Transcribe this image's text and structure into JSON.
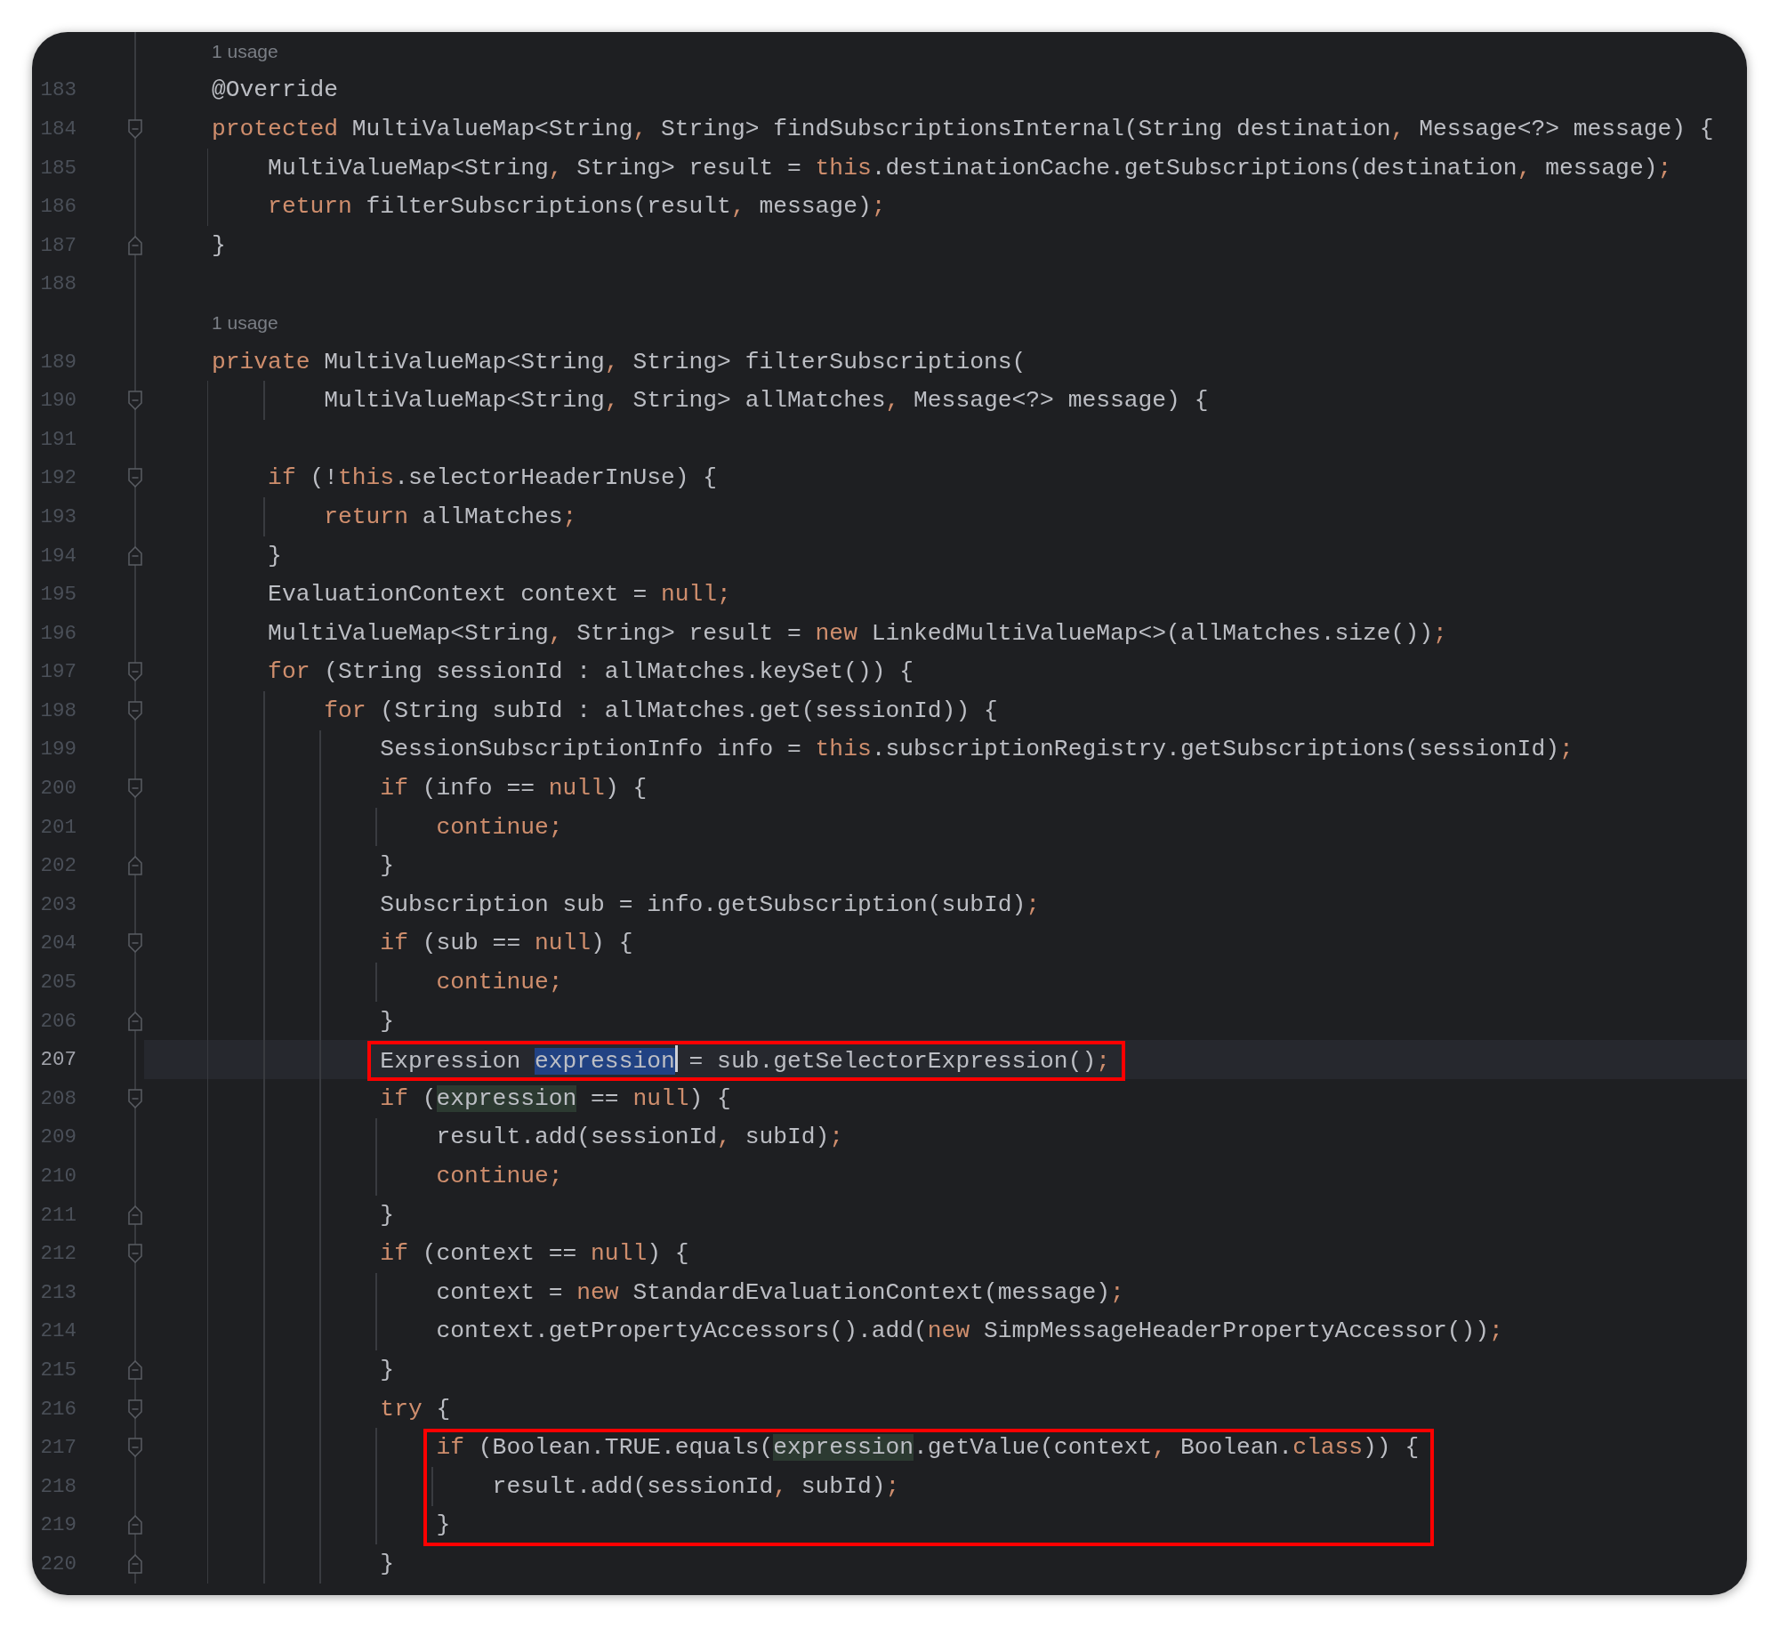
{
  "editor": {
    "lines": [
      {
        "kind": "usage",
        "text": "1 usage",
        "current": false,
        "boxed": false
      },
      {
        "kind": "code",
        "number": "183",
        "current": false,
        "boxed": false,
        "tokens": [
          {
            "kind": "plain",
            "text": "@Override"
          }
        ]
      },
      {
        "kind": "code",
        "number": "184",
        "current": false,
        "boxed": false,
        "fold": {
          "kind": "open"
        },
        "tokens": [
          {
            "kind": "keyword",
            "text": "protected"
          },
          {
            "kind": "plain",
            "text": " MultiValueMap<String"
          },
          {
            "kind": "keyword",
            "text": ","
          },
          {
            "kind": "plain",
            "text": " String> findSubscriptionsInternal(String destination"
          },
          {
            "kind": "keyword",
            "text": ","
          },
          {
            "kind": "plain",
            "text": " Message<?> message) {"
          }
        ]
      },
      {
        "kind": "code",
        "number": "185",
        "current": false,
        "boxed": false,
        "tokens": [
          {
            "kind": "plain",
            "text": "    MultiValueMap<String"
          },
          {
            "kind": "keyword",
            "text": ","
          },
          {
            "kind": "plain",
            "text": " String> result = "
          },
          {
            "kind": "keyword",
            "text": "this"
          },
          {
            "kind": "plain",
            "text": ".destinationCache.getSubscriptions(destination"
          },
          {
            "kind": "keyword",
            "text": ","
          },
          {
            "kind": "plain",
            "text": " message)"
          },
          {
            "kind": "keyword",
            "text": ";"
          }
        ]
      },
      {
        "kind": "code",
        "number": "186",
        "current": false,
        "boxed": false,
        "tokens": [
          {
            "kind": "keyword",
            "text": "    return"
          },
          {
            "kind": "plain",
            "text": " filterSubscriptions(result"
          },
          {
            "kind": "keyword",
            "text": ","
          },
          {
            "kind": "plain",
            "text": " message)"
          },
          {
            "kind": "keyword",
            "text": ";"
          }
        ]
      },
      {
        "kind": "code",
        "number": "187",
        "current": false,
        "boxed": false,
        "fold": {
          "kind": "close"
        },
        "tokens": [
          {
            "kind": "plain",
            "text": "}"
          }
        ]
      },
      {
        "kind": "code",
        "number": "188",
        "current": false,
        "boxed": false
      },
      {
        "kind": "usage",
        "text": "1 usage",
        "current": false,
        "boxed": false
      },
      {
        "kind": "code",
        "number": "189",
        "current": false,
        "boxed": false,
        "tokens": [
          {
            "kind": "keyword",
            "text": "private"
          },
          {
            "kind": "plain",
            "text": " MultiValueMap<String"
          },
          {
            "kind": "keyword",
            "text": ","
          },
          {
            "kind": "plain",
            "text": " String> filterSubscriptions("
          }
        ]
      },
      {
        "kind": "code",
        "number": "190",
        "current": false,
        "boxed": false,
        "fold": {
          "kind": "open"
        },
        "tokens": [
          {
            "kind": "plain",
            "text": "        MultiValueMap<String"
          },
          {
            "kind": "keyword",
            "text": ","
          },
          {
            "kind": "plain",
            "text": " String> allMatches"
          },
          {
            "kind": "keyword",
            "text": ","
          },
          {
            "kind": "plain",
            "text": " Message<?> message) {"
          }
        ]
      },
      {
        "kind": "code",
        "number": "191",
        "current": false,
        "boxed": false
      },
      {
        "kind": "code",
        "number": "192",
        "current": false,
        "boxed": false,
        "fold": {
          "kind": "open"
        },
        "tokens": [
          {
            "kind": "keyword",
            "text": "    if"
          },
          {
            "kind": "plain",
            "text": " (!"
          },
          {
            "kind": "keyword",
            "text": "this"
          },
          {
            "kind": "plain",
            "text": ".selectorHeaderInUse) {"
          }
        ]
      },
      {
        "kind": "code",
        "number": "193",
        "current": false,
        "boxed": false,
        "tokens": [
          {
            "kind": "keyword",
            "text": "        return"
          },
          {
            "kind": "plain",
            "text": " allMatches"
          },
          {
            "kind": "keyword",
            "text": ";"
          }
        ]
      },
      {
        "kind": "code",
        "number": "194",
        "current": false,
        "boxed": false,
        "fold": {
          "kind": "close"
        },
        "tokens": [
          {
            "kind": "plain",
            "text": "    }"
          }
        ]
      },
      {
        "kind": "code",
        "number": "195",
        "current": false,
        "boxed": false,
        "tokens": [
          {
            "kind": "plain",
            "text": "    EvaluationContext context = "
          },
          {
            "kind": "keyword",
            "text": "null;"
          }
        ]
      },
      {
        "kind": "code",
        "number": "196",
        "current": false,
        "boxed": false,
        "tokens": [
          {
            "kind": "plain",
            "text": "    MultiValueMap<String"
          },
          {
            "kind": "keyword",
            "text": ","
          },
          {
            "kind": "plain",
            "text": " String> result = "
          },
          {
            "kind": "keyword",
            "text": "new"
          },
          {
            "kind": "plain",
            "text": " LinkedMultiValueMap<>(allMatches.size())"
          },
          {
            "kind": "keyword",
            "text": ";"
          }
        ]
      },
      {
        "kind": "code",
        "number": "197",
        "current": false,
        "boxed": false,
        "fold": {
          "kind": "open"
        },
        "tokens": [
          {
            "kind": "keyword",
            "text": "    for"
          },
          {
            "kind": "plain",
            "text": " (String sessionId : allMatches.keySet()) {"
          }
        ]
      },
      {
        "kind": "code",
        "number": "198",
        "current": false,
        "boxed": false,
        "fold": {
          "kind": "open"
        },
        "tokens": [
          {
            "kind": "keyword",
            "text": "        for"
          },
          {
            "kind": "plain",
            "text": " (String subId : allMatches.get(sessionId)) {"
          }
        ]
      },
      {
        "kind": "code",
        "number": "199",
        "current": false,
        "boxed": false,
        "tokens": [
          {
            "kind": "plain",
            "text": "            SessionSubscriptionInfo info = "
          },
          {
            "kind": "keyword",
            "text": "this"
          },
          {
            "kind": "plain",
            "text": ".subscriptionRegistry.getSubscriptions(sessionId)"
          },
          {
            "kind": "keyword",
            "text": ";"
          }
        ]
      },
      {
        "kind": "code",
        "number": "200",
        "current": false,
        "boxed": false,
        "fold": {
          "kind": "open"
        },
        "tokens": [
          {
            "kind": "keyword",
            "text": "            if"
          },
          {
            "kind": "plain",
            "text": " (info == "
          },
          {
            "kind": "keyword",
            "text": "null"
          },
          {
            "kind": "plain",
            "text": ") {"
          }
        ]
      },
      {
        "kind": "code",
        "number": "201",
        "current": false,
        "boxed": false,
        "tokens": [
          {
            "kind": "keyword",
            "text": "                continue;"
          }
        ]
      },
      {
        "kind": "code",
        "number": "202",
        "current": false,
        "boxed": false,
        "fold": {
          "kind": "close"
        },
        "tokens": [
          {
            "kind": "plain",
            "text": "            }"
          }
        ]
      },
      {
        "kind": "code",
        "number": "203",
        "current": false,
        "boxed": false,
        "tokens": [
          {
            "kind": "plain",
            "text": "            Subscription sub = info.getSubscription(subId)"
          },
          {
            "kind": "keyword",
            "text": ";"
          }
        ]
      },
      {
        "kind": "code",
        "number": "204",
        "current": false,
        "boxed": false,
        "fold": {
          "kind": "open"
        },
        "tokens": [
          {
            "kind": "keyword",
            "text": "            if"
          },
          {
            "kind": "plain",
            "text": " (sub == "
          },
          {
            "kind": "keyword",
            "text": "null"
          },
          {
            "kind": "plain",
            "text": ") {"
          }
        ]
      },
      {
        "kind": "code",
        "number": "205",
        "current": false,
        "boxed": false,
        "tokens": [
          {
            "kind": "keyword",
            "text": "                continue;"
          }
        ]
      },
      {
        "kind": "code",
        "number": "206",
        "current": false,
        "boxed": false,
        "fold": {
          "kind": "close"
        },
        "tokens": [
          {
            "kind": "plain",
            "text": "            }"
          }
        ]
      },
      {
        "kind": "code",
        "number": "207",
        "current": true,
        "boxed": true,
        "tokens": [
          {
            "kind": "plain",
            "text": "            Expression "
          },
          {
            "kind": "selected",
            "text": "expression"
          },
          {
            "kind": "caret"
          },
          {
            "kind": "plain",
            "text": " = sub.getSelectorExpression()"
          },
          {
            "kind": "keyword",
            "text": ";"
          }
        ]
      },
      {
        "kind": "code",
        "number": "208",
        "current": false,
        "boxed": false,
        "fold": {
          "kind": "open"
        },
        "tokens": [
          {
            "kind": "keyword",
            "text": "            if"
          },
          {
            "kind": "plain",
            "text": " ("
          },
          {
            "kind": "reference",
            "text": "expression"
          },
          {
            "kind": "plain",
            "text": " == "
          },
          {
            "kind": "keyword",
            "text": "null"
          },
          {
            "kind": "plain",
            "text": ") {"
          }
        ]
      },
      {
        "kind": "code",
        "number": "209",
        "current": false,
        "boxed": false,
        "tokens": [
          {
            "kind": "plain",
            "text": "                result.add(sessionId"
          },
          {
            "kind": "keyword",
            "text": ","
          },
          {
            "kind": "plain",
            "text": " subId)"
          },
          {
            "kind": "keyword",
            "text": ";"
          }
        ]
      },
      {
        "kind": "code",
        "number": "210",
        "current": false,
        "boxed": false,
        "tokens": [
          {
            "kind": "keyword",
            "text": "                continue;"
          }
        ]
      },
      {
        "kind": "code",
        "number": "211",
        "current": false,
        "boxed": false,
        "fold": {
          "kind": "close"
        },
        "tokens": [
          {
            "kind": "plain",
            "text": "            }"
          }
        ]
      },
      {
        "kind": "code",
        "number": "212",
        "current": false,
        "boxed": false,
        "fold": {
          "kind": "open"
        },
        "tokens": [
          {
            "kind": "keyword",
            "text": "            if"
          },
          {
            "kind": "plain",
            "text": " (context == "
          },
          {
            "kind": "keyword",
            "text": "null"
          },
          {
            "kind": "plain",
            "text": ") {"
          }
        ]
      },
      {
        "kind": "code",
        "number": "213",
        "current": false,
        "boxed": false,
        "tokens": [
          {
            "kind": "plain",
            "text": "                context = "
          },
          {
            "kind": "keyword",
            "text": "new"
          },
          {
            "kind": "plain",
            "text": " StandardEvaluationContext(message)"
          },
          {
            "kind": "keyword",
            "text": ";"
          }
        ]
      },
      {
        "kind": "code",
        "number": "214",
        "current": false,
        "boxed": false,
        "tokens": [
          {
            "kind": "plain",
            "text": "                context.getPropertyAccessors().add("
          },
          {
            "kind": "keyword",
            "text": "new"
          },
          {
            "kind": "plain",
            "text": " SimpMessageHeaderPropertyAccessor())"
          },
          {
            "kind": "keyword",
            "text": ";"
          }
        ]
      },
      {
        "kind": "code",
        "number": "215",
        "current": false,
        "boxed": false,
        "fold": {
          "kind": "close"
        },
        "tokens": [
          {
            "kind": "plain",
            "text": "            }"
          }
        ]
      },
      {
        "kind": "code",
        "number": "216",
        "current": false,
        "boxed": false,
        "fold": {
          "kind": "open"
        },
        "tokens": [
          {
            "kind": "keyword",
            "text": "            try"
          },
          {
            "kind": "plain",
            "text": " {"
          }
        ]
      },
      {
        "kind": "code",
        "number": "217",
        "current": false,
        "boxed": true,
        "fold": {
          "kind": "open"
        },
        "tokens": [
          {
            "kind": "keyword",
            "text": "                if"
          },
          {
            "kind": "plain",
            "text": " (Boolean.TRUE.equals("
          },
          {
            "kind": "reference",
            "text": "expression"
          },
          {
            "kind": "plain",
            "text": ".getValue(context"
          },
          {
            "kind": "keyword",
            "text": ","
          },
          {
            "kind": "plain",
            "text": " Boolean."
          },
          {
            "kind": "keyword",
            "text": "class"
          },
          {
            "kind": "plain",
            "text": ")) {"
          }
        ]
      },
      {
        "kind": "code",
        "number": "218",
        "current": false,
        "boxed": true,
        "tokens": [
          {
            "kind": "plain",
            "text": "                    result.add(sessionId"
          },
          {
            "kind": "keyword",
            "text": ","
          },
          {
            "kind": "plain",
            "text": " subId)"
          },
          {
            "kind": "keyword",
            "text": ";"
          }
        ]
      },
      {
        "kind": "code",
        "number": "219",
        "current": false,
        "boxed": true,
        "fold": {
          "kind": "close"
        },
        "tokens": [
          {
            "kind": "plain",
            "text": "                }"
          }
        ]
      },
      {
        "kind": "code",
        "number": "220",
        "current": false,
        "boxed": false,
        "fold": {
          "kind": "close"
        },
        "tokens": [
          {
            "kind": "plain",
            "text": "            }"
          }
        ]
      }
    ]
  }
}
